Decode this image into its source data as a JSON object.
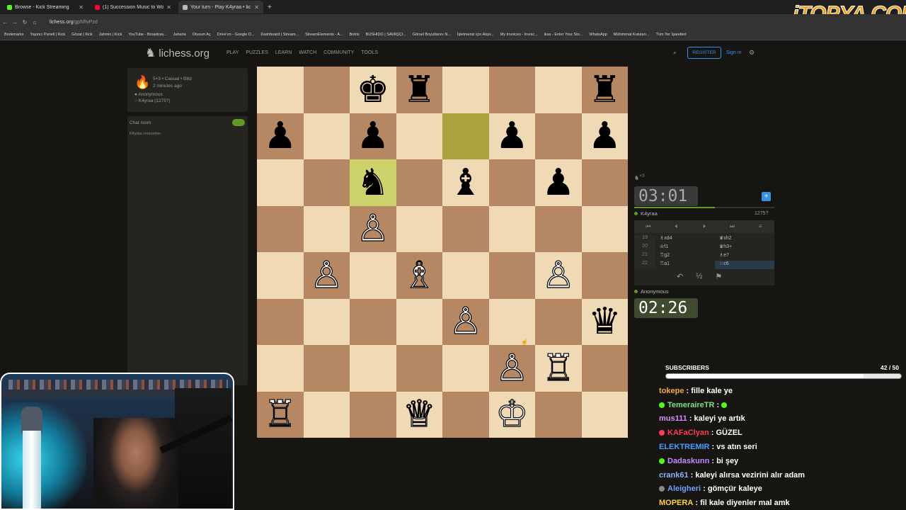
{
  "browser": {
    "tabs": [
      {
        "title": "Browse - Kick Streaming",
        "icon_color": "#53fc18"
      },
      {
        "title": "(1) Succession Music to Wo",
        "icon_color": "#ff0033"
      },
      {
        "title": "Your turn - Play K4yraa • lic",
        "icon_color": "#bababa"
      }
    ],
    "new_tab": "+",
    "url_host": "lichess.org",
    "url_path": "/gpNfIvPzd",
    "bookmarks": [
      "Bookmarks",
      "Yayıncı Paneli | Kick",
      "Gözat | Kick",
      "Jahmin | Kick",
      "YouTube - Broadcas...",
      "Jaharia",
      "Oturum Aç",
      "Drive'ım - Google D...",
      "Dashboard | Stream...",
      "StreamElements - A...",
      "Botrix",
      "BUSHIDO | SAVAŞÇI...",
      "Görsel Boyutlarını N...",
      "İşletmeniz için Alışv...",
      "My Invoices - Invoic...",
      "ikas - Enter Your Sto...",
      "WhatsApp",
      "Mühimmat Kutuları...",
      "Tüm Yer İşaretleri"
    ]
  },
  "overlay_logo": "iTOPYA.COM",
  "lichess": {
    "brand": "lichess.org",
    "menu": [
      "PLAY",
      "PUZZLES",
      "LEARN",
      "WATCH",
      "COMMUNITY",
      "TOOLS"
    ],
    "register": "REGISTER",
    "signin": "Sign in",
    "game": {
      "mode": "5+3 • Casual • Blitz",
      "time_ago": "2 minutes ago",
      "white_player": "Anonymous",
      "black_player": "K4yraa (1275?)"
    },
    "chat_label": "Chat room",
    "chat_message": "K4yraa verecekler",
    "captured": "+3",
    "opponent_clock": "03:01",
    "opponent_name": "K4yraa",
    "opponent_rating": "1275?",
    "player_clock": "02:26",
    "player_name": "Anonymous",
    "move_controls": [
      "⏮",
      "⏴",
      "⏵",
      "⏭",
      "≡"
    ],
    "moves": [
      {
        "n": "19",
        "w": "♗xd4",
        "b": "♛xh2"
      },
      {
        "n": "20",
        "w": "♔f1",
        "b": "♛h3+"
      },
      {
        "n": "21",
        "w": "♖g2",
        "b": "♗e7"
      },
      {
        "n": "22",
        "w": "♖a1",
        "b": "♘c6"
      }
    ],
    "actions": [
      "↶",
      "½",
      "⚑"
    ],
    "board": [
      [
        "",
        "",
        "♚",
        "♜",
        "",
        "",
        "",
        "♜"
      ],
      [
        "♟",
        "",
        "♟",
        "",
        "",
        "♟",
        "",
        "♟"
      ],
      [
        "",
        "",
        "♞",
        "",
        "♝",
        "",
        "♟",
        ""
      ],
      [
        "",
        "",
        "♙",
        "",
        "",
        "",
        "",
        ""
      ],
      [
        "",
        "♙",
        "",
        "♗",
        "",
        "",
        "♙",
        ""
      ],
      [
        "",
        "",
        "",
        "",
        "♙",
        "",
        "",
        "♛"
      ],
      [
        "",
        "",
        "",
        "",
        "",
        "♙",
        "♖",
        ""
      ],
      [
        "♖",
        "",
        "",
        "♕",
        "",
        "♔",
        "",
        ""
      ]
    ]
  },
  "stream": {
    "subs_label": "SUBSCRIBERS",
    "subs_count": "42 / 50",
    "subs_progress": 0.84,
    "chat": [
      {
        "user": "tokepe",
        "color": "#f2a93b",
        "text": "fille kale ye",
        "badge": ""
      },
      {
        "user": "TemeraireTR",
        "color": "#7fe07f",
        "text": "",
        "badge": "#53fc18"
      },
      {
        "user": "mus111",
        "color": "#d88cff",
        "text": "kaleyi ye artık",
        "badge": ""
      },
      {
        "user": "KAFaClyan",
        "color": "#ff3a5a",
        "text": "GÜZEL",
        "badge": "#ff3a5a"
      },
      {
        "user": "ELEKTREMIR",
        "color": "#4a9cff",
        "text": "vs atın seri",
        "badge": ""
      },
      {
        "user": "Dadaskunn",
        "color": "#c48aff",
        "text": "bi şey",
        "badge": "#53fc18"
      },
      {
        "user": "crank61",
        "color": "#8ab4f8",
        "text": "kaleyi alırsa vezirini alır adam",
        "badge": ""
      },
      {
        "user": "Aleigheri",
        "color": "#6fa0ff",
        "text": "gömçür kaleye",
        "badge": "#888888"
      },
      {
        "user": "MOPERA",
        "color": "#ffd23a",
        "text": "fil kale diyenler mal amk",
        "badge": ""
      }
    ]
  }
}
